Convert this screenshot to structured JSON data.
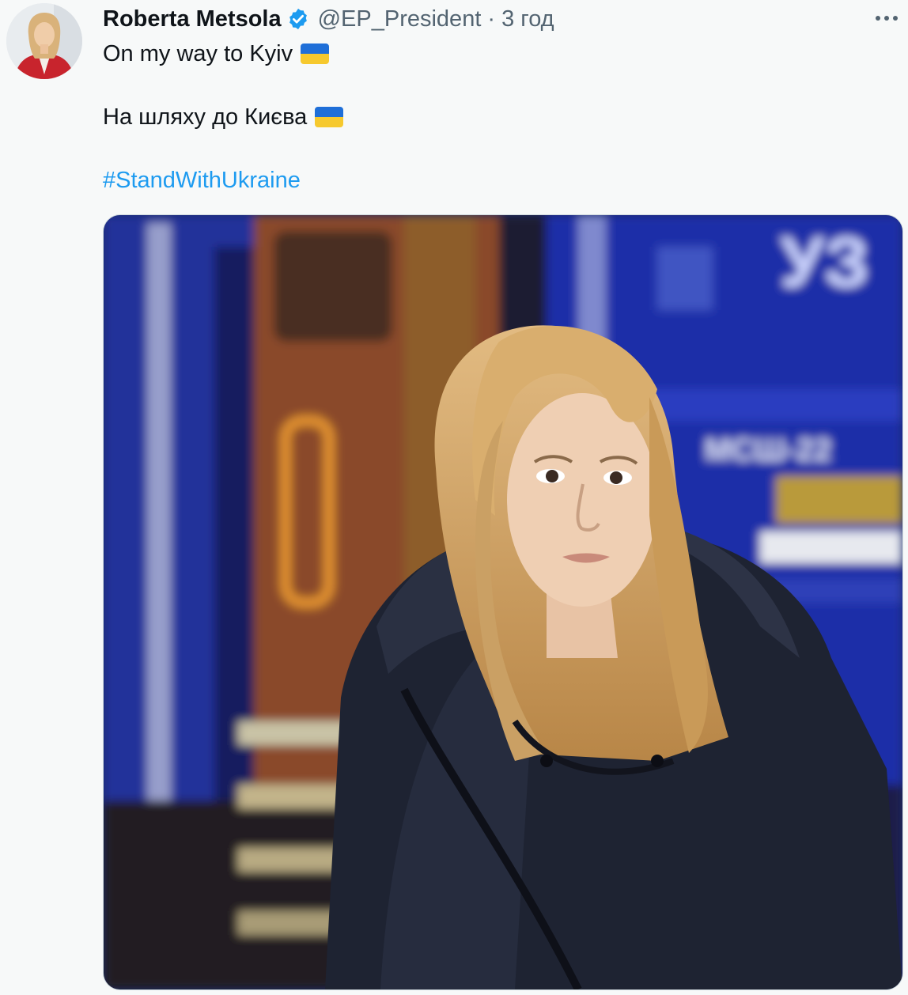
{
  "author": {
    "name": "Roberta Metsola",
    "handle": "@EP_President",
    "separator": "·",
    "time": "3 год"
  },
  "icons": {
    "verified": "verified-badge-icon",
    "more": "more-options-icon"
  },
  "tweet": {
    "line1": "On my way to Kyiv",
    "line2": "На шляху до Києва",
    "hashtag": "#StandWithUkraine"
  },
  "media": {
    "train_logo": "УЗ",
    "train_marking": "МСШ-22"
  },
  "colors": {
    "accent": "#1d9bf0",
    "flag_blue": "#1f6fd8",
    "flag_yellow": "#f6c92e"
  }
}
